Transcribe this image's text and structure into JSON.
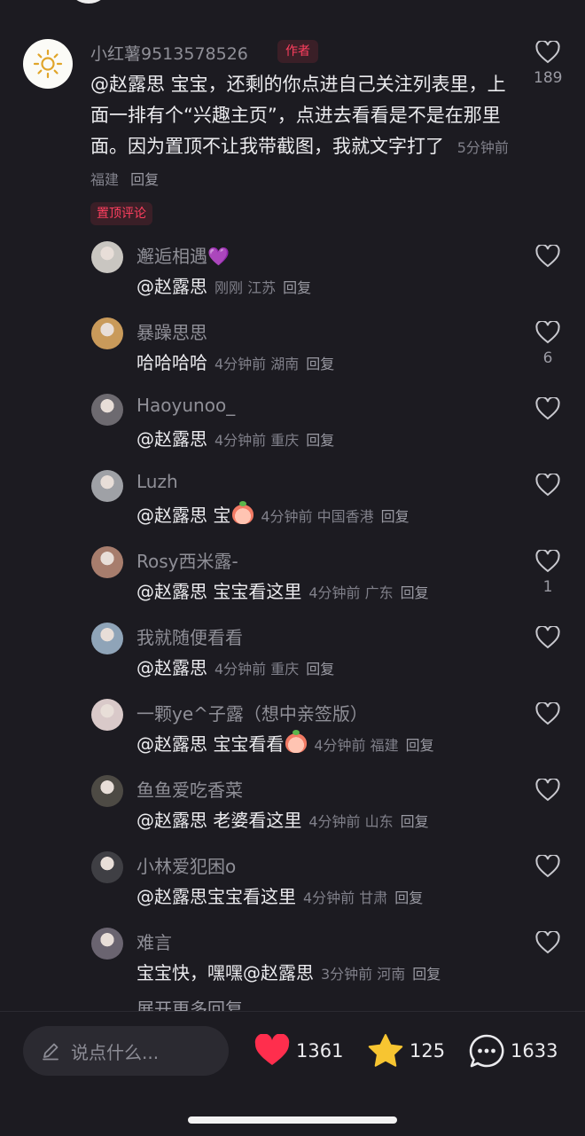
{
  "main_comment": {
    "username": "小红薯9513578526",
    "author_badge": "作者",
    "text": "@赵露思 宝宝，还剩的你点进自己关注列表里，上面一排有个“兴趣主页”，点进去看看是不是在那里面。因为置顶不让我带截图，我就文字打了",
    "time": "5分钟前",
    "location": "福建",
    "reply_label": "回复",
    "pinned_badge": "置顶评论",
    "likes": "189"
  },
  "replies": [
    {
      "username": "邂逅相遇💜",
      "text": "@赵露思",
      "time": "刚刚",
      "location": "江苏",
      "reply_label": "回复",
      "likes": "",
      "avatar_color": "#c9c6c1"
    },
    {
      "username": "暴躁思思",
      "text": "哈哈哈哈",
      "time": "4分钟前",
      "location": "湖南",
      "reply_label": "回复",
      "likes": "6",
      "avatar_color": "#c99a5a"
    },
    {
      "username": "Haoyunoo_",
      "text": "@赵露思",
      "time": "4分钟前",
      "location": "重庆",
      "reply_label": "回复",
      "likes": "",
      "avatar_color": "#6d6a70"
    },
    {
      "username": "Luzh",
      "text": "@赵露思 宝",
      "emoji": "peach",
      "time": "4分钟前",
      "location": "中国香港",
      "reply_label": "回复",
      "likes": "",
      "avatar_color": "#9fa1a6"
    },
    {
      "username": "Rosy西米露-",
      "text": "@赵露思 宝宝看这里",
      "time": "4分钟前",
      "location": "广东",
      "reply_label": "回复",
      "likes": "1",
      "avatar_color": "#a77d6d"
    },
    {
      "username": "我就随便看看",
      "text": "@赵露思",
      "time": "4分钟前",
      "location": "重庆",
      "reply_label": "回复",
      "likes": "",
      "avatar_color": "#8fa4b8"
    },
    {
      "username": "一颗ye^子露（想中亲签版）",
      "text": "@赵露思 宝宝看看",
      "emoji": "peach",
      "time": "4分钟前",
      "location": "福建",
      "reply_label": "回复",
      "likes": "",
      "avatar_color": "#d9c9c9"
    },
    {
      "username": "鱼鱼爱吃香菜",
      "text": "@赵露思 老婆看这里",
      "time": "4分钟前",
      "location": "山东",
      "reply_label": "回复",
      "likes": "",
      "avatar_color": "#4d4a44"
    },
    {
      "username": "小林爱犯困o",
      "text": "@赵露思宝宝看这里",
      "time": "4分钟前",
      "location": "甘肃",
      "reply_label": "回复",
      "likes": "",
      "avatar_color": "#3f3f44"
    },
    {
      "username": "难言",
      "text": "宝宝快，嘿嘿@赵露思",
      "time": "3分钟前",
      "location": "河南",
      "reply_label": "回复",
      "likes": "",
      "avatar_color": "#6a6470"
    }
  ],
  "expand_more": "展开更多回复",
  "bottom_bar": {
    "input_placeholder": "说点什么...",
    "likes": "1361",
    "favorites": "125",
    "comments": "1633"
  },
  "colors": {
    "background": "#1c1b21",
    "badge_red": "#ff3f5f",
    "heart_red": "#ff2e4d",
    "star_yellow": "#f7c531"
  },
  "icons": [
    "sun-avatar-icon",
    "heart-outline-icon",
    "pencil-icon",
    "heart-filled-icon",
    "star-icon",
    "comment-bubble-icon"
  ]
}
